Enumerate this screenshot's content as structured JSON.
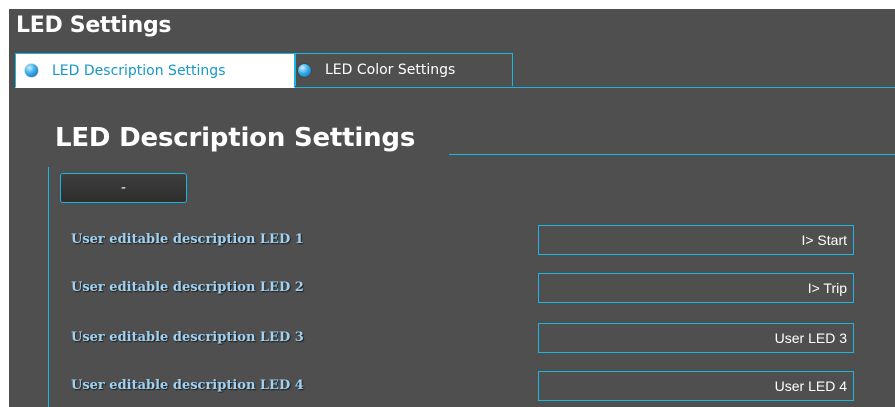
{
  "panel": {
    "title": "LED Settings"
  },
  "tabs": [
    {
      "label": "LED Description Settings",
      "active": true
    },
    {
      "label": "LED Color Settings",
      "active": false
    }
  ],
  "section": {
    "title": "LED Description Settings",
    "collapse_label": "-"
  },
  "rows": [
    {
      "label": "User editable description LED 1",
      "value": "I> Start"
    },
    {
      "label": "User editable description LED 2",
      "value": "I> Trip"
    },
    {
      "label": "User editable description LED 3",
      "value": "User LED 3"
    },
    {
      "label": "User editable description LED 4",
      "value": "User LED 4"
    }
  ],
  "colors": {
    "accent": "#19b6e0",
    "panel_bg": "#4f4f4f",
    "label": "#9fd2f2"
  }
}
